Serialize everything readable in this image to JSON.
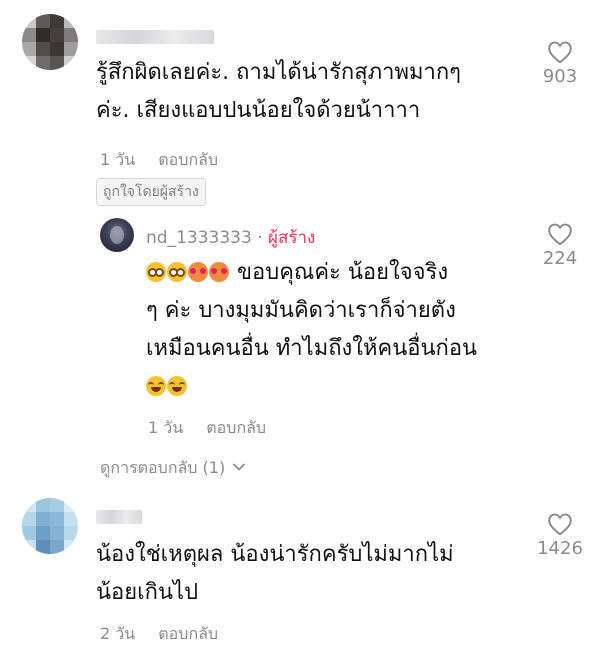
{
  "comments": [
    {
      "text_line1": "รู้สึกผิดเลยค่ะ. ถามได้น่ารักสุภาพมากๆ",
      "text_line2": "ค่ะ. เสียงแอบปนน้อยใจด้วยน้าาาา",
      "time": "1 วัน",
      "reply_label": "ตอบกลับ",
      "creator_liked": "ถูกใจโดยผู้สร้าง",
      "likes": "903"
    },
    {
      "username": "nd_1333333",
      "separator": "·",
      "creator_badge": "ผู้สร้าง",
      "text_line1": "ขอบคุณค่ะ น้อยใจจริง",
      "text_line2": "ๆ ค่ะ บางมุมมันคิดว่าเราก็จ่ายตัง",
      "text_line3": "เหมือนคนอื่น ทำไมถึงให้คนอื่นก่อน",
      "time": "1 วัน",
      "reply_label": "ตอบกลับ",
      "likes": "224"
    },
    {
      "text_line1": "น้องใช่เหตุผล น้องน่ารักครับไม่มากไม่",
      "text_line2": "น้อยเกินไป",
      "time": "2 วัน",
      "reply_label": "ตอบกลับ",
      "likes": "1426"
    }
  ],
  "view_replies": "ดูการตอบกลับ (1)",
  "icons": {
    "like": "heart-outline-icon",
    "expand": "chevron-down-icon"
  },
  "colors": {
    "creator_badge": "#fe2c55",
    "muted": "#8a8b91"
  }
}
